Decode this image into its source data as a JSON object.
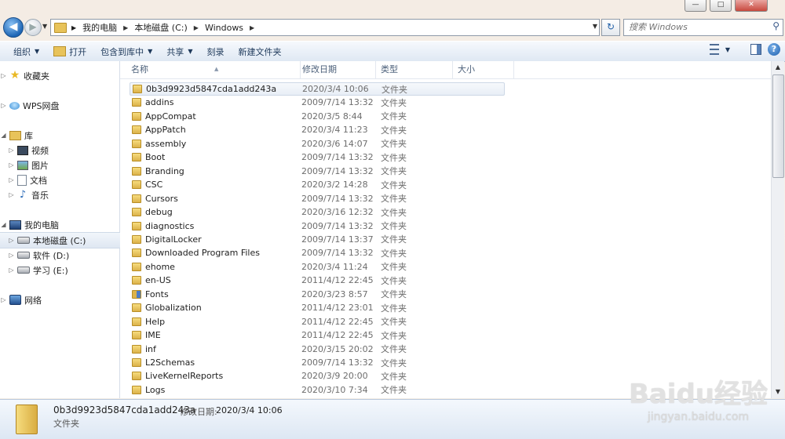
{
  "window": {
    "minimize": "—",
    "maximize": "□",
    "close": "✕"
  },
  "address": {
    "crumbs": [
      "我的电脑",
      "本地磁盘 (C:)",
      "Windows"
    ],
    "search_placeholder": "搜索 Windows"
  },
  "toolbar": {
    "organize": "组织",
    "open": "打开",
    "include_in_library": "包含到库中",
    "share": "共享",
    "burn": "刻录",
    "new_folder": "新建文件夹"
  },
  "nav": {
    "favorites": "收藏夹",
    "wps": "WPS网盘",
    "libraries": "库",
    "videos": "视频",
    "pictures": "图片",
    "documents": "文档",
    "music": "音乐",
    "computer": "我的电脑",
    "drive_c": "本地磁盘 (C:)",
    "drive_d": "软件 (D:)",
    "drive_e": "学习 (E:)",
    "network": "网络"
  },
  "columns": {
    "name": "名称",
    "modified": "修改日期",
    "type": "类型",
    "size": "大小"
  },
  "files": [
    {
      "name": "0b3d9923d5847cda1add243a",
      "date": "2020/3/4 10:06",
      "type": "文件夹"
    },
    {
      "name": "addins",
      "date": "2009/7/14 13:32",
      "type": "文件夹"
    },
    {
      "name": "AppCompat",
      "date": "2020/3/5 8:44",
      "type": "文件夹"
    },
    {
      "name": "AppPatch",
      "date": "2020/3/4 11:23",
      "type": "文件夹"
    },
    {
      "name": "assembly",
      "date": "2020/3/6 14:07",
      "type": "文件夹"
    },
    {
      "name": "Boot",
      "date": "2009/7/14 13:32",
      "type": "文件夹"
    },
    {
      "name": "Branding",
      "date": "2009/7/14 13:32",
      "type": "文件夹"
    },
    {
      "name": "CSC",
      "date": "2020/3/2 14:28",
      "type": "文件夹"
    },
    {
      "name": "Cursors",
      "date": "2009/7/14 13:32",
      "type": "文件夹"
    },
    {
      "name": "debug",
      "date": "2020/3/16 12:32",
      "type": "文件夹"
    },
    {
      "name": "diagnostics",
      "date": "2009/7/14 13:32",
      "type": "文件夹"
    },
    {
      "name": "DigitalLocker",
      "date": "2009/7/14 13:37",
      "type": "文件夹"
    },
    {
      "name": "Downloaded Program Files",
      "date": "2009/7/14 13:32",
      "type": "文件夹"
    },
    {
      "name": "ehome",
      "date": "2020/3/4 11:24",
      "type": "文件夹"
    },
    {
      "name": "en-US",
      "date": "2011/4/12 22:45",
      "type": "文件夹"
    },
    {
      "name": "Fonts",
      "date": "2020/3/23 8:57",
      "type": "文件夹"
    },
    {
      "name": "Globalization",
      "date": "2011/4/12 23:01",
      "type": "文件夹"
    },
    {
      "name": "Help",
      "date": "2011/4/12 22:45",
      "type": "文件夹"
    },
    {
      "name": "IME",
      "date": "2011/4/12 22:45",
      "type": "文件夹"
    },
    {
      "name": "inf",
      "date": "2020/3/15 20:02",
      "type": "文件夹"
    },
    {
      "name": "L2Schemas",
      "date": "2009/7/14 13:32",
      "type": "文件夹"
    },
    {
      "name": "LiveKernelReports",
      "date": "2020/3/9 20:00",
      "type": "文件夹"
    },
    {
      "name": "Logs",
      "date": "2020/3/10 7:34",
      "type": "文件夹"
    }
  ],
  "details": {
    "name": "0b3d9923d5847cda1add243a",
    "modified_label": "修改日期:",
    "modified_value": "2020/3/4 10:06",
    "type": "文件夹"
  },
  "watermark": {
    "brand": "Baidu经验",
    "url": "jingyan.baidu.com"
  }
}
